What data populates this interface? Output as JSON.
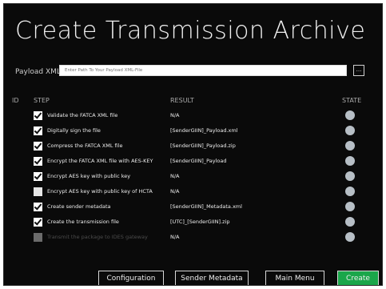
{
  "window": {
    "title": "Create Transmission Archive"
  },
  "payload": {
    "label": "Payload XML",
    "placeholder": "Enter Path To Your Payload XML-File",
    "browse_label": "..."
  },
  "table": {
    "headers": {
      "id": "ID",
      "step": "STEP",
      "result": "RESULT",
      "state": "STATE"
    },
    "rows": [
      {
        "checked": "on",
        "step": "Validate the FATCA XML file",
        "result": "N/A"
      },
      {
        "checked": "on",
        "step": "Digitally sign the file",
        "result": "[SenderGIIN]_Payload.xml"
      },
      {
        "checked": "on",
        "step": "Compress the FATCA XML file",
        "result": "[SenderGIIN]_Payload.zip"
      },
      {
        "checked": "on",
        "step": "Encrypt the FATCA XML file with AES-KEY",
        "result": "[SenderGIIN]_Payload"
      },
      {
        "checked": "on",
        "step": "Encrypt AES key with public key",
        "result": "N/A"
      },
      {
        "checked": "off",
        "step": "Encrypt AES key with public key of HCTA",
        "result": "N/A"
      },
      {
        "checked": "on",
        "step": "Create sender metadata",
        "result": "[SenderGIIN]_Metadata.xml"
      },
      {
        "checked": "on",
        "step": "Create the transmission file",
        "result": "[UTC]_[SenderGIIN].zip"
      },
      {
        "checked": "disabled",
        "step": "Transmit the package to IDES gateway",
        "result": "N/A"
      }
    ]
  },
  "buttons": {
    "configuration": "Configuration",
    "sender_metadata": "Sender Metadata",
    "main_menu": "Main Menu",
    "create": "Create"
  },
  "colors": {
    "background": "#0a0a0a",
    "accent": "#1aa64a",
    "state_indicator": "#b7bfc6"
  }
}
